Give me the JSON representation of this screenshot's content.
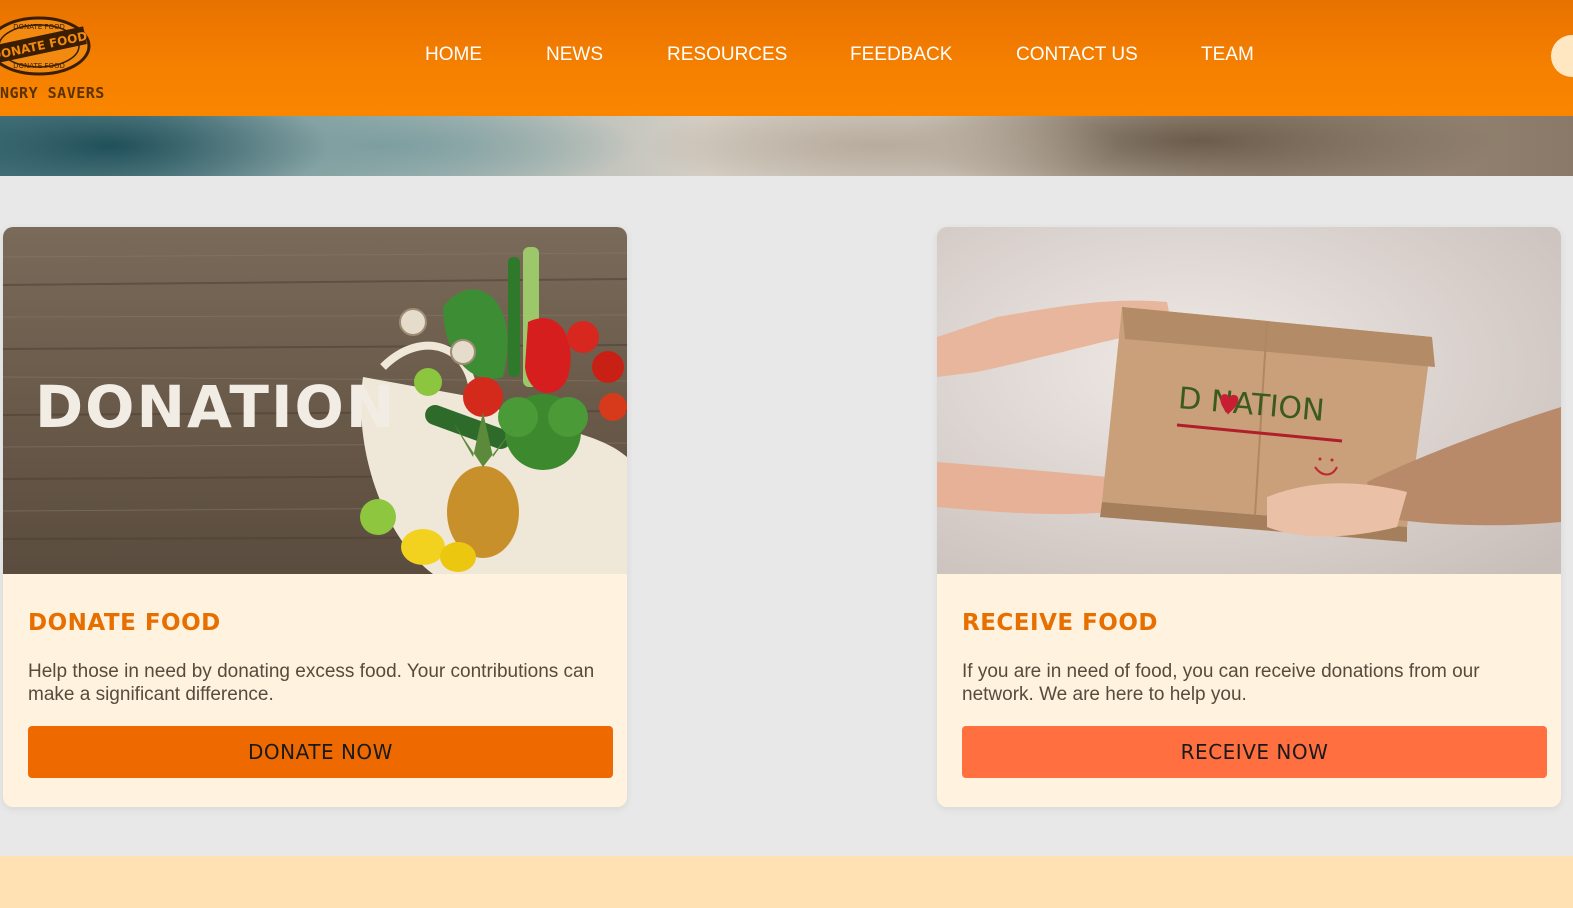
{
  "brand": {
    "logo_text_top": "DONATE FOOD",
    "logo_text_main": "DONATE FOOD",
    "logo_text_bottom": "DONATE FOOD",
    "name": "NGRY SAVERS"
  },
  "nav": {
    "items": [
      {
        "label": "HOME"
      },
      {
        "label": "NEWS"
      },
      {
        "label": "RESOURCES"
      },
      {
        "label": "FEEDBACK"
      },
      {
        "label": "CONTACT US"
      },
      {
        "label": "TEAM"
      }
    ]
  },
  "cards": [
    {
      "image_text": "DONATION",
      "title": "DONATE FOOD",
      "description": "Help those in need by donating excess food. Your contributions can make a significant difference.",
      "button_label": "DONATE NOW"
    },
    {
      "image_text": "D NATION",
      "title": "RECEIVE FOOD",
      "description": "If you are in need of food, you can receive donations from our network. We are here to help you.",
      "button_label": "RECEIVE NOW"
    }
  ],
  "colors": {
    "header": "#f57f00",
    "accent_title": "#e76f00",
    "donate_button": "#ee6a00",
    "receive_button": "#ff6f3f",
    "card_bg": "#fff2de",
    "footer": "#ffe1b4"
  }
}
